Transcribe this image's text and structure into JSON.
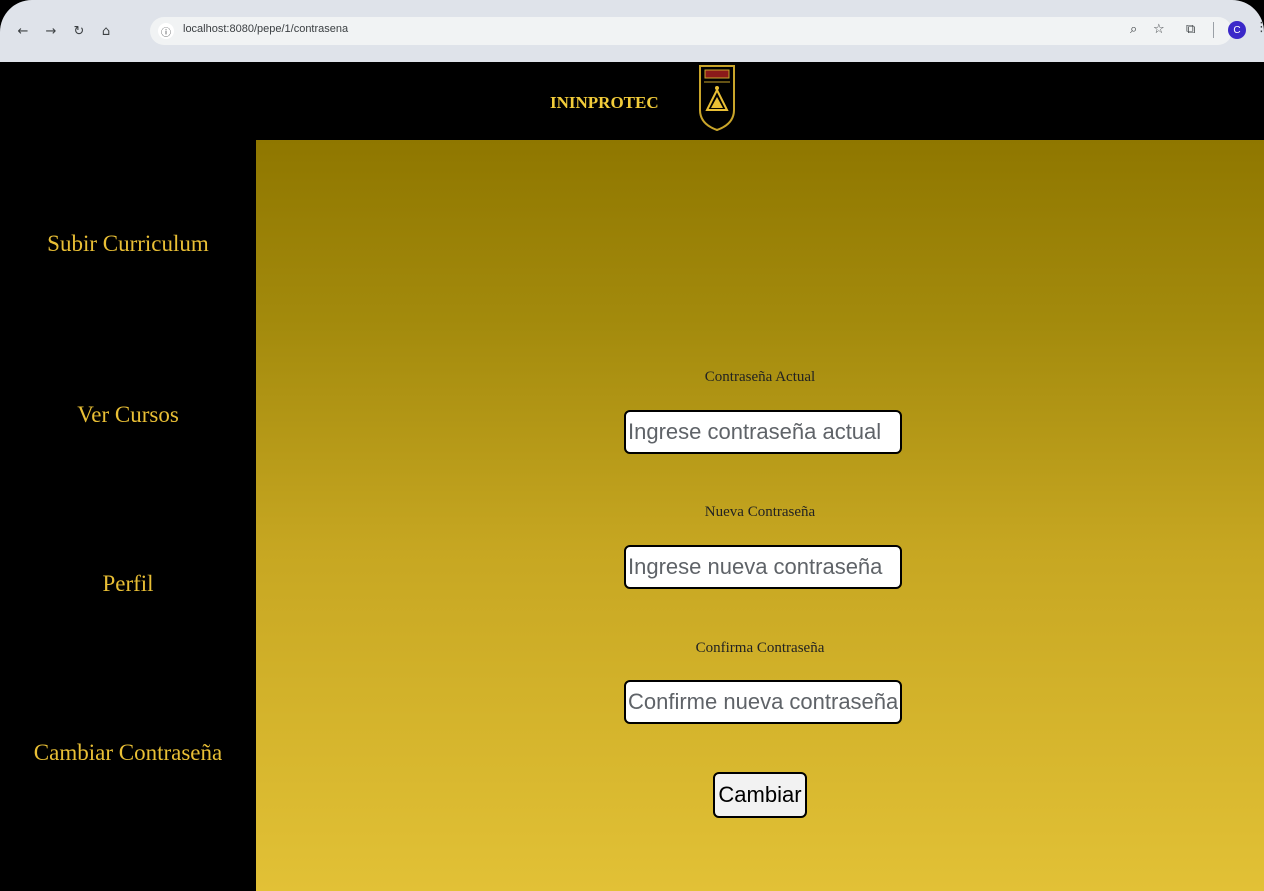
{
  "browser": {
    "url": "localhost:8080/pepe/1/contrasena",
    "profile_initial": "C"
  },
  "header": {
    "brand": "ININPROTEC"
  },
  "sidebar": {
    "items": [
      {
        "label": "Subir Curriculum"
      },
      {
        "label": "Ver Cursos"
      },
      {
        "label": "Perfil"
      },
      {
        "label": "Cambiar Contraseña"
      }
    ]
  },
  "form": {
    "current": {
      "label": "Contraseña Actual",
      "placeholder": "Ingrese contraseña actual"
    },
    "new": {
      "label": "Nueva Contraseña",
      "placeholder": "Ingrese nueva contraseña"
    },
    "confirm": {
      "label": "Confirma Contraseña",
      "placeholder": "Confirme nueva contraseña"
    },
    "submit_label": "Cambiar"
  },
  "colors": {
    "accent": "#e9bf35",
    "gradient_top": "#8f7700",
    "gradient_bottom": "#e2c136"
  }
}
